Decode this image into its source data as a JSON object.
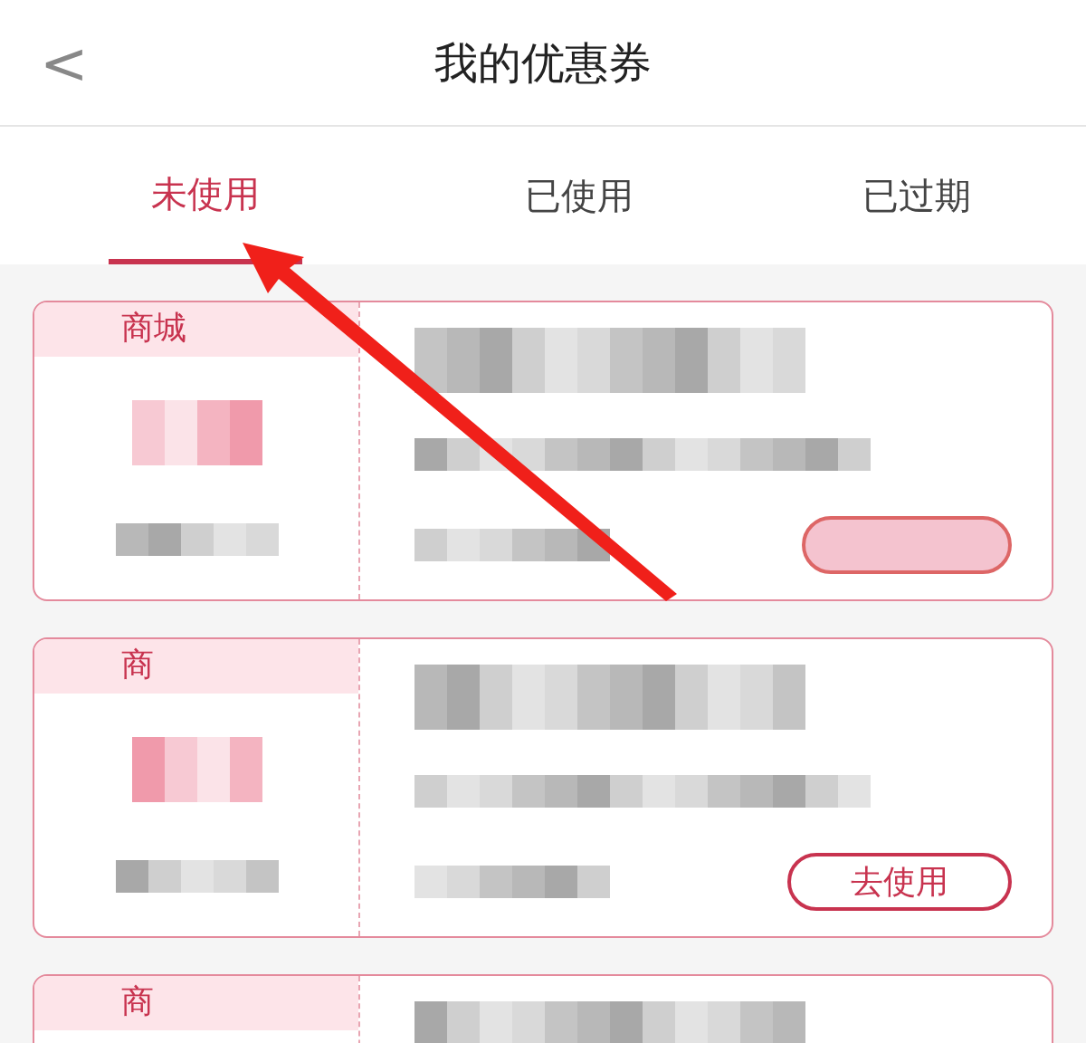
{
  "header": {
    "back": "<",
    "title": "我的优惠券"
  },
  "tabs": [
    {
      "label": "未使用",
      "selected": true
    },
    {
      "label": "已使用",
      "selected": false
    },
    {
      "label": "已过期",
      "selected": false
    }
  ],
  "coupons": [
    {
      "tag": "商城",
      "button_redacted": true
    },
    {
      "tag": "商",
      "button": "去使用"
    },
    {
      "tag": "商"
    }
  ]
}
